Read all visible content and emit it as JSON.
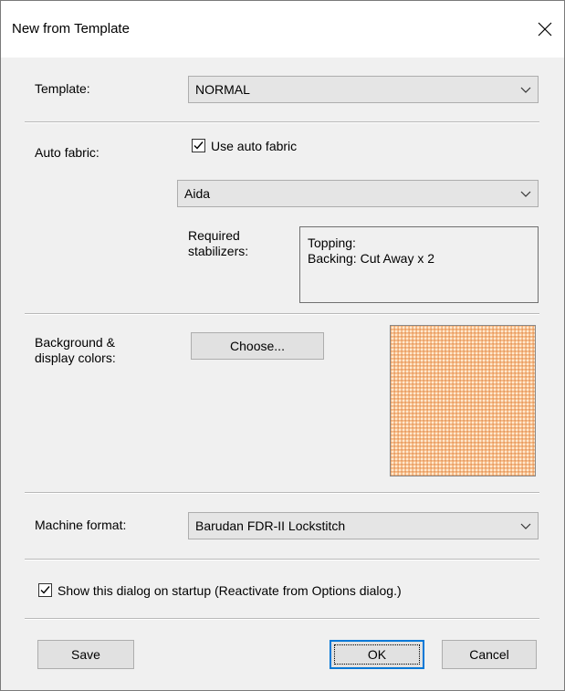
{
  "dialog": {
    "title": "New from Template"
  },
  "template": {
    "label": "Template:",
    "selected": "NORMAL"
  },
  "auto_fabric": {
    "label": "Auto fabric:",
    "checkbox_label": "Use auto fabric",
    "checked": true,
    "fabric_selected": "Aida",
    "stabilizers_label_line1": "Required",
    "stabilizers_label_line2": "stabilizers:",
    "stabilizers_line1": "Topping:",
    "stabilizers_line2": "Backing: Cut Away x 2"
  },
  "background": {
    "label_line1": "Background &",
    "label_line2": "display colors:",
    "choose_button": "Choose...",
    "swatch_color": "#f6b47c"
  },
  "machine": {
    "label": "Machine format:",
    "selected": "Barudan FDR-II Lockstitch"
  },
  "startup": {
    "checkbox_label": "Show this dialog on startup (Reactivate from Options dialog.)",
    "checked": true
  },
  "buttons": {
    "save": "Save",
    "ok": "OK",
    "cancel": "Cancel"
  },
  "icons": {
    "close": "close-icon",
    "dropdown": "chevron-down-icon",
    "check": "checkmark-icon"
  }
}
